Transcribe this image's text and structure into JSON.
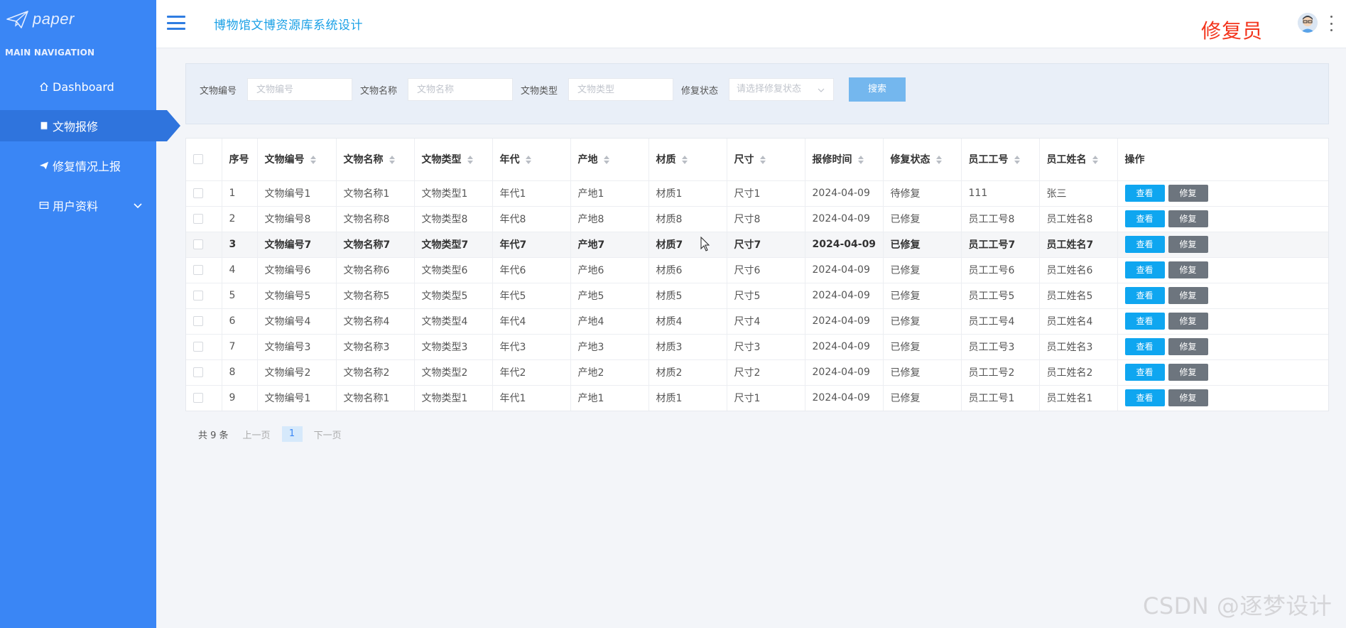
{
  "sidebar": {
    "logo_text": "paper",
    "heading": "MAIN NAVIGATION",
    "items": [
      {
        "label": "Dashboard",
        "icon": "home-icon"
      },
      {
        "label": "文物报修",
        "icon": "bookmark-icon",
        "active": true
      },
      {
        "label": "修复情况上报",
        "icon": "paper-plane-icon"
      },
      {
        "label": "用户资料",
        "icon": "id-card-icon",
        "has_submenu": true
      }
    ]
  },
  "header": {
    "title": "博物馆文博资源库系统设计",
    "role": "修复员",
    "colors": {
      "title": "#1aa0e6",
      "role": "#f3341c",
      "sidebar": "#3a86f5"
    }
  },
  "search": {
    "fields": [
      {
        "label": "文物编号",
        "placeholder": "文物编号"
      },
      {
        "label": "文物名称",
        "placeholder": "文物名称"
      },
      {
        "label": "文物类型",
        "placeholder": "文物类型"
      }
    ],
    "status_label": "修复状态",
    "status_placeholder": "请选择修复状态",
    "button": "搜索"
  },
  "table": {
    "headers": [
      "序号",
      "文物编号",
      "文物名称",
      "文物类型",
      "年代",
      "产地",
      "材质",
      "尺寸",
      "报修时间",
      "修复状态",
      "员工工号",
      "员工姓名",
      "操作"
    ],
    "view_label": "查看",
    "repair_label": "修复",
    "rows": [
      {
        "seq": "1",
        "code": "文物编号1",
        "name": "文物名称1",
        "type": "文物类型1",
        "era": "年代1",
        "origin": "产地1",
        "material": "材质1",
        "size": "尺寸1",
        "time": "2024-04-09",
        "status": "待修复",
        "emp_no": "111",
        "emp_name": "张三"
      },
      {
        "seq": "2",
        "code": "文物编号8",
        "name": "文物名称8",
        "type": "文物类型8",
        "era": "年代8",
        "origin": "产地8",
        "material": "材质8",
        "size": "尺寸8",
        "time": "2024-04-09",
        "status": "已修复",
        "emp_no": "员工工号8",
        "emp_name": "员工姓名8"
      },
      {
        "seq": "3",
        "code": "文物编号7",
        "name": "文物名称7",
        "type": "文物类型7",
        "era": "年代7",
        "origin": "产地7",
        "material": "材质7",
        "size": "尺寸7",
        "time": "2024-04-09",
        "status": "已修复",
        "emp_no": "员工工号7",
        "emp_name": "员工姓名7"
      },
      {
        "seq": "4",
        "code": "文物编号6",
        "name": "文物名称6",
        "type": "文物类型6",
        "era": "年代6",
        "origin": "产地6",
        "material": "材质6",
        "size": "尺寸6",
        "time": "2024-04-09",
        "status": "已修复",
        "emp_no": "员工工号6",
        "emp_name": "员工姓名6"
      },
      {
        "seq": "5",
        "code": "文物编号5",
        "name": "文物名称5",
        "type": "文物类型5",
        "era": "年代5",
        "origin": "产地5",
        "material": "材质5",
        "size": "尺寸5",
        "time": "2024-04-09",
        "status": "已修复",
        "emp_no": "员工工号5",
        "emp_name": "员工姓名5"
      },
      {
        "seq": "6",
        "code": "文物编号4",
        "name": "文物名称4",
        "type": "文物类型4",
        "era": "年代4",
        "origin": "产地4",
        "material": "材质4",
        "size": "尺寸4",
        "time": "2024-04-09",
        "status": "已修复",
        "emp_no": "员工工号4",
        "emp_name": "员工姓名4"
      },
      {
        "seq": "7",
        "code": "文物编号3",
        "name": "文物名称3",
        "type": "文物类型3",
        "era": "年代3",
        "origin": "产地3",
        "material": "材质3",
        "size": "尺寸3",
        "time": "2024-04-09",
        "status": "已修复",
        "emp_no": "员工工号3",
        "emp_name": "员工姓名3"
      },
      {
        "seq": "8",
        "code": "文物编号2",
        "name": "文物名称2",
        "type": "文物类型2",
        "era": "年代2",
        "origin": "产地2",
        "material": "材质2",
        "size": "尺寸2",
        "time": "2024-04-09",
        "status": "已修复",
        "emp_no": "员工工号2",
        "emp_name": "员工姓名2"
      },
      {
        "seq": "9",
        "code": "文物编号1",
        "name": "文物名称1",
        "type": "文物类型1",
        "era": "年代1",
        "origin": "产地1",
        "material": "材质1",
        "size": "尺寸1",
        "time": "2024-04-09",
        "status": "已修复",
        "emp_no": "员工工号1",
        "emp_name": "员工姓名1"
      }
    ]
  },
  "pagination": {
    "total": "共 9 条",
    "prev": "上一页",
    "current": "1",
    "next": "下一页"
  },
  "watermark": "CSDN @逐梦设计"
}
